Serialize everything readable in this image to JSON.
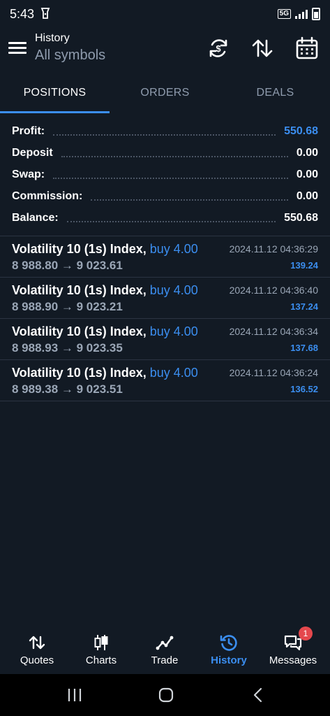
{
  "status_bar": {
    "time": "5:43",
    "network": "5G"
  },
  "header": {
    "title": "History",
    "subtitle": "All symbols"
  },
  "tabs": [
    {
      "label": "POSITIONS",
      "active": true
    },
    {
      "label": "ORDERS",
      "active": false
    },
    {
      "label": "DEALS",
      "active": false
    }
  ],
  "summary": {
    "profit_label": "Profit:",
    "profit": "550.68",
    "deposit_label": "Deposit",
    "deposit": "0.00",
    "swap_label": "Swap:",
    "swap": "0.00",
    "commission_label": "Commission:",
    "commission": "0.00",
    "balance_label": "Balance:",
    "balance": "550.68"
  },
  "deals": [
    {
      "symbol": "Volatility 10 (1s) Index,",
      "direction": "buy 4.00",
      "prices": "8 988.80 → 9 023.61",
      "time": "2024.11.12 04:36:29",
      "profit": "139.24"
    },
    {
      "symbol": "Volatility 10 (1s) Index,",
      "direction": "buy 4.00",
      "prices": "8 988.90 → 9 023.21",
      "time": "2024.11.12 04:36:40",
      "profit": "137.24"
    },
    {
      "symbol": "Volatility 10 (1s) Index,",
      "direction": "buy 4.00",
      "prices": "8 988.93 → 9 023.35",
      "time": "2024.11.12 04:36:34",
      "profit": "137.68"
    },
    {
      "symbol": "Volatility 10 (1s) Index,",
      "direction": "buy 4.00",
      "prices": "8 989.38 → 9 023.51",
      "time": "2024.11.12 04:36:24",
      "profit": "136.52"
    }
  ],
  "bottom_nav": [
    {
      "label": "Quotes",
      "icon": "quotes-icon",
      "active": false
    },
    {
      "label": "Charts",
      "icon": "charts-icon",
      "active": false
    },
    {
      "label": "Trade",
      "icon": "trade-icon",
      "active": false
    },
    {
      "label": "History",
      "icon": "history-icon",
      "active": true
    },
    {
      "label": "Messages",
      "icon": "messages-icon",
      "active": false,
      "badge": "1"
    }
  ],
  "colors": {
    "accent": "#3b8ef0",
    "background": "#121a24",
    "badge": "#e5484d"
  }
}
